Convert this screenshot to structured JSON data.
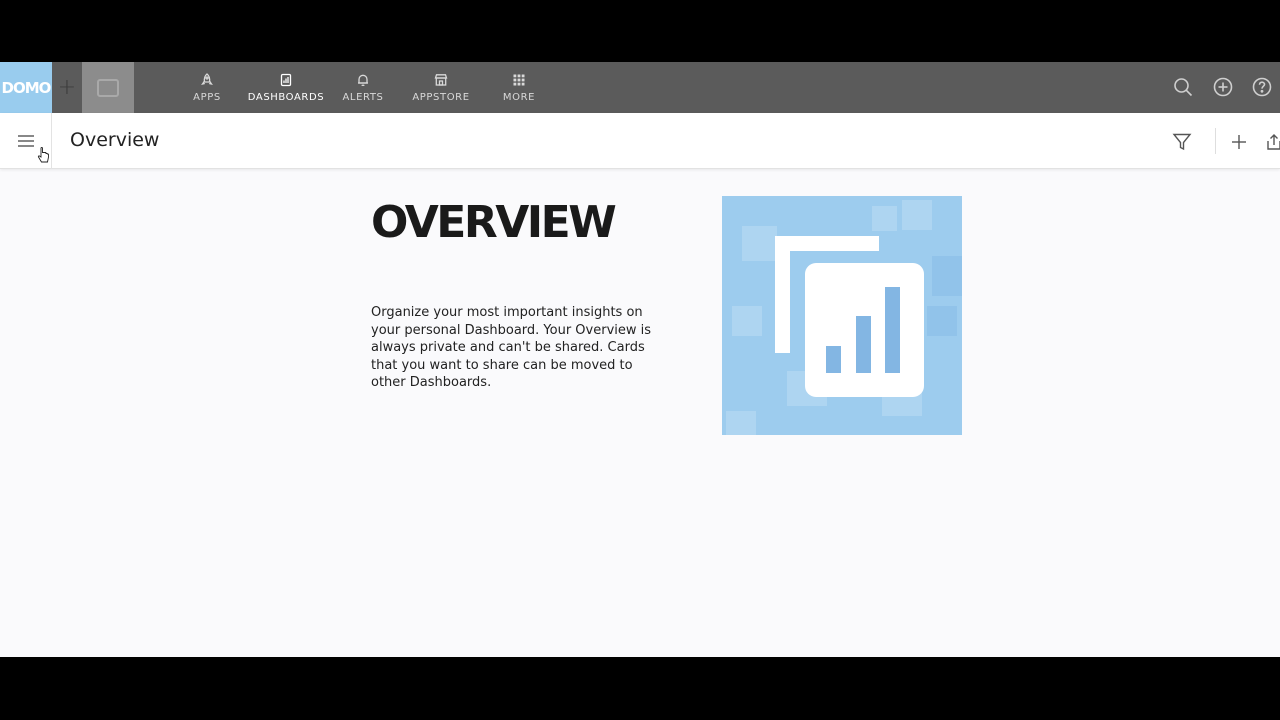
{
  "app": {
    "logo_text": "DOMO",
    "accent_color": "#99ccee",
    "nav_bg": "#5b5b5b"
  },
  "nav": {
    "items": [
      {
        "label": "APPS",
        "icon": "rocket-icon"
      },
      {
        "label": "DASHBOARDS",
        "icon": "dashboard-icon",
        "active": true
      },
      {
        "label": "ALERTS",
        "icon": "bell-icon"
      },
      {
        "label": "APPSTORE",
        "icon": "store-icon"
      },
      {
        "label": "MORE",
        "icon": "grid-icon"
      }
    ],
    "right_icons": [
      "search-icon",
      "add-circle-icon",
      "help-icon"
    ]
  },
  "page": {
    "title": "Overview",
    "toolbar_icons": [
      "filter-icon",
      "plus-icon",
      "share-icon"
    ]
  },
  "content": {
    "heading": "OVERVIEW",
    "description": "Organize your most important insights on your personal Dashboard. Your Overview is always private and can't be shared. Cards that you want to share can be moved to other Dashboards.",
    "illustration": "dashboard-chart-illustration"
  }
}
